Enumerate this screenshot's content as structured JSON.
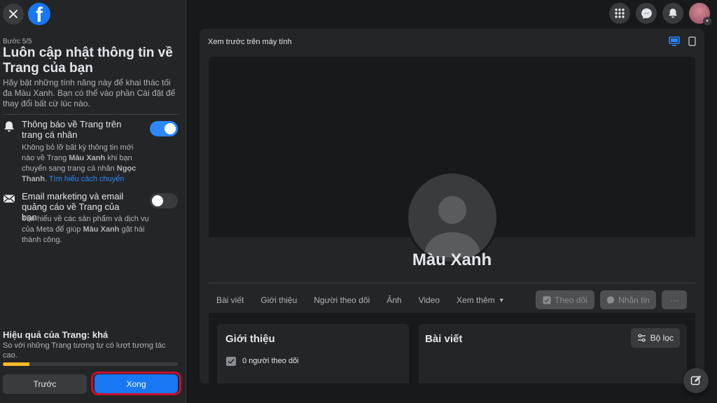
{
  "colors": {
    "accent": "#1877f2",
    "toggle_on": "#2d88ff",
    "progress": "#f7b928",
    "highlight_ring": "#c8102e"
  },
  "left_panel": {
    "step": "Bước 5/5",
    "title": "Luôn cập nhật thông tin về Trang của bạn",
    "description": "Hãy bật những tính năng này để khai thác tối đa Màu Xanh. Bạn có thể vào phần Cài đặt để thay đổi bất cứ lúc nào.",
    "settings": [
      {
        "icon": "bell-icon",
        "title": "Thông báo về Trang trên trang cá nhân",
        "desc_1": "Không bỏ lỡ bất kỳ thông tin mới nào về Trang ",
        "desc_bold_1": "Màu Xanh",
        "desc_2": " khi bạn chuyển sang trang cá nhân ",
        "desc_bold_2": "Ngọc Thanh",
        "desc_3": ". ",
        "link": "Tìm hiểu cách chuyển",
        "enabled": true
      },
      {
        "icon": "envelope-icon",
        "title": "Email marketing và email quảng cáo về Trang của bạn",
        "desc_1": "Tìm hiểu về các sản phẩm và dịch vụ của Meta để giúp ",
        "desc_bold_1": "Màu Xanh",
        "desc_2": " gặt hái thành công.",
        "enabled": false
      }
    ],
    "performance": {
      "title": "Hiệu quả của Trang: khá",
      "description": "So với những Trang tương tự có lượt tương tác cao.",
      "progress": 0.15
    },
    "buttons": {
      "prev": "Trước",
      "done": "Xong"
    }
  },
  "top_right_icons": [
    "apps-menu-icon",
    "messenger-icon",
    "notifications-bell-icon",
    "profile-avatar"
  ],
  "preview": {
    "label": "Xem trước trên máy tính",
    "devices": [
      "desktop-icon",
      "mobile-icon"
    ],
    "page_name": "Màu Xanh",
    "tabs": [
      "Bài viết",
      "Giới thiệu",
      "Người theo dõi",
      "Ảnh",
      "Video",
      "Xem thêm"
    ],
    "actions": {
      "follow": "Theo dõi",
      "message": "Nhắn tin",
      "more": "···"
    },
    "intro": {
      "title": "Giới thiệu",
      "followers": "0 người theo dõi"
    },
    "posts": {
      "title": "Bài viết",
      "filter": "Bộ lọc"
    }
  }
}
